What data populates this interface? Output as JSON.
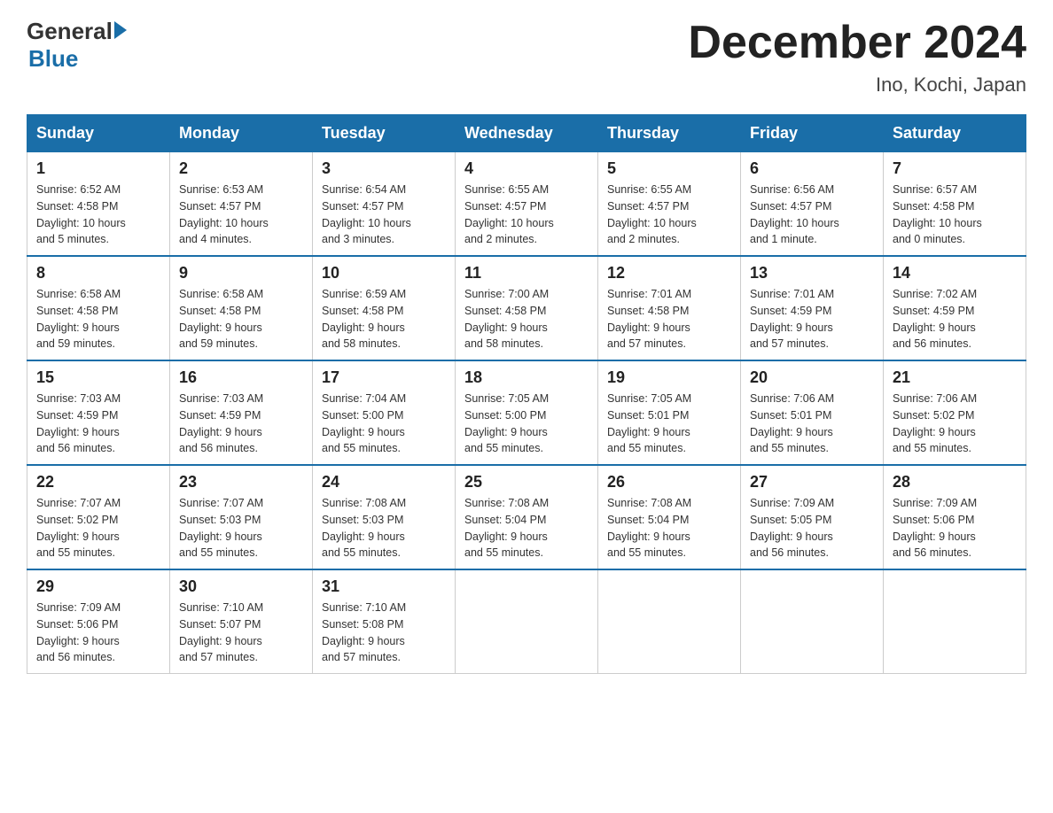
{
  "logo": {
    "general": "General",
    "blue": "Blue"
  },
  "title": "December 2024",
  "subtitle": "Ino, Kochi, Japan",
  "days_of_week": [
    "Sunday",
    "Monday",
    "Tuesday",
    "Wednesday",
    "Thursday",
    "Friday",
    "Saturday"
  ],
  "weeks": [
    [
      {
        "day": "1",
        "sunrise": "6:52 AM",
        "sunset": "4:58 PM",
        "daylight": "10 hours and 5 minutes."
      },
      {
        "day": "2",
        "sunrise": "6:53 AM",
        "sunset": "4:57 PM",
        "daylight": "10 hours and 4 minutes."
      },
      {
        "day": "3",
        "sunrise": "6:54 AM",
        "sunset": "4:57 PM",
        "daylight": "10 hours and 3 minutes."
      },
      {
        "day": "4",
        "sunrise": "6:55 AM",
        "sunset": "4:57 PM",
        "daylight": "10 hours and 2 minutes."
      },
      {
        "day": "5",
        "sunrise": "6:55 AM",
        "sunset": "4:57 PM",
        "daylight": "10 hours and 2 minutes."
      },
      {
        "day": "6",
        "sunrise": "6:56 AM",
        "sunset": "4:57 PM",
        "daylight": "10 hours and 1 minute."
      },
      {
        "day": "7",
        "sunrise": "6:57 AM",
        "sunset": "4:58 PM",
        "daylight": "10 hours and 0 minutes."
      }
    ],
    [
      {
        "day": "8",
        "sunrise": "6:58 AM",
        "sunset": "4:58 PM",
        "daylight": "9 hours and 59 minutes."
      },
      {
        "day": "9",
        "sunrise": "6:58 AM",
        "sunset": "4:58 PM",
        "daylight": "9 hours and 59 minutes."
      },
      {
        "day": "10",
        "sunrise": "6:59 AM",
        "sunset": "4:58 PM",
        "daylight": "9 hours and 58 minutes."
      },
      {
        "day": "11",
        "sunrise": "7:00 AM",
        "sunset": "4:58 PM",
        "daylight": "9 hours and 58 minutes."
      },
      {
        "day": "12",
        "sunrise": "7:01 AM",
        "sunset": "4:58 PM",
        "daylight": "9 hours and 57 minutes."
      },
      {
        "day": "13",
        "sunrise": "7:01 AM",
        "sunset": "4:59 PM",
        "daylight": "9 hours and 57 minutes."
      },
      {
        "day": "14",
        "sunrise": "7:02 AM",
        "sunset": "4:59 PM",
        "daylight": "9 hours and 56 minutes."
      }
    ],
    [
      {
        "day": "15",
        "sunrise": "7:03 AM",
        "sunset": "4:59 PM",
        "daylight": "9 hours and 56 minutes."
      },
      {
        "day": "16",
        "sunrise": "7:03 AM",
        "sunset": "4:59 PM",
        "daylight": "9 hours and 56 minutes."
      },
      {
        "day": "17",
        "sunrise": "7:04 AM",
        "sunset": "5:00 PM",
        "daylight": "9 hours and 55 minutes."
      },
      {
        "day": "18",
        "sunrise": "7:05 AM",
        "sunset": "5:00 PM",
        "daylight": "9 hours and 55 minutes."
      },
      {
        "day": "19",
        "sunrise": "7:05 AM",
        "sunset": "5:01 PM",
        "daylight": "9 hours and 55 minutes."
      },
      {
        "day": "20",
        "sunrise": "7:06 AM",
        "sunset": "5:01 PM",
        "daylight": "9 hours and 55 minutes."
      },
      {
        "day": "21",
        "sunrise": "7:06 AM",
        "sunset": "5:02 PM",
        "daylight": "9 hours and 55 minutes."
      }
    ],
    [
      {
        "day": "22",
        "sunrise": "7:07 AM",
        "sunset": "5:02 PM",
        "daylight": "9 hours and 55 minutes."
      },
      {
        "day": "23",
        "sunrise": "7:07 AM",
        "sunset": "5:03 PM",
        "daylight": "9 hours and 55 minutes."
      },
      {
        "day": "24",
        "sunrise": "7:08 AM",
        "sunset": "5:03 PM",
        "daylight": "9 hours and 55 minutes."
      },
      {
        "day": "25",
        "sunrise": "7:08 AM",
        "sunset": "5:04 PM",
        "daylight": "9 hours and 55 minutes."
      },
      {
        "day": "26",
        "sunrise": "7:08 AM",
        "sunset": "5:04 PM",
        "daylight": "9 hours and 55 minutes."
      },
      {
        "day": "27",
        "sunrise": "7:09 AM",
        "sunset": "5:05 PM",
        "daylight": "9 hours and 56 minutes."
      },
      {
        "day": "28",
        "sunrise": "7:09 AM",
        "sunset": "5:06 PM",
        "daylight": "9 hours and 56 minutes."
      }
    ],
    [
      {
        "day": "29",
        "sunrise": "7:09 AM",
        "sunset": "5:06 PM",
        "daylight": "9 hours and 56 minutes."
      },
      {
        "day": "30",
        "sunrise": "7:10 AM",
        "sunset": "5:07 PM",
        "daylight": "9 hours and 57 minutes."
      },
      {
        "day": "31",
        "sunrise": "7:10 AM",
        "sunset": "5:08 PM",
        "daylight": "9 hours and 57 minutes."
      },
      null,
      null,
      null,
      null
    ]
  ],
  "labels": {
    "sunrise": "Sunrise:",
    "sunset": "Sunset:",
    "daylight": "Daylight:"
  }
}
